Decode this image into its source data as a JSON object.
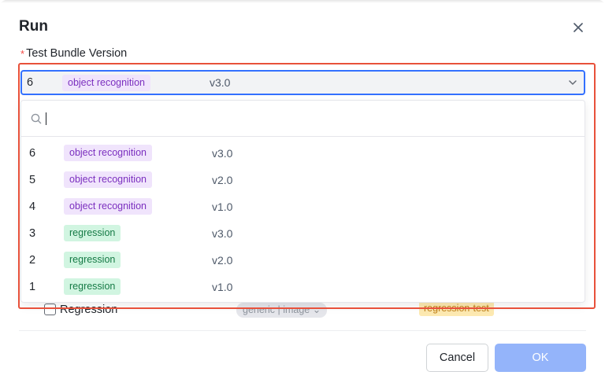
{
  "dialog": {
    "title": "Run",
    "close_icon": "close-icon"
  },
  "field": {
    "required_mark": "*",
    "label": "Test Bundle Version",
    "selected": {
      "id": "6",
      "tag": "object recognition",
      "tag_color": "purple",
      "version": "v3.0"
    }
  },
  "search": {
    "placeholder": "",
    "value": ""
  },
  "options": [
    {
      "id": "6",
      "tag": "object recognition",
      "tag_color": "purple",
      "version": "v3.0"
    },
    {
      "id": "5",
      "tag": "object recognition",
      "tag_color": "purple",
      "version": "v2.0"
    },
    {
      "id": "4",
      "tag": "object recognition",
      "tag_color": "purple",
      "version": "v1.0"
    },
    {
      "id": "3",
      "tag": "regression",
      "tag_color": "green",
      "version": "v3.0"
    },
    {
      "id": "2",
      "tag": "regression",
      "tag_color": "green",
      "version": "v2.0"
    },
    {
      "id": "1",
      "tag": "regression",
      "tag_color": "green",
      "version": "v1.0"
    }
  ],
  "background_row": {
    "label": "Regression",
    "type_tag": "generic | image",
    "label_tag": "regression-test"
  },
  "footer": {
    "cancel_label": "Cancel",
    "ok_label": "OK"
  },
  "colors": {
    "accent": "#3370ff",
    "highlight": "#e8513b",
    "ok_disabled": "#94b4fa"
  }
}
